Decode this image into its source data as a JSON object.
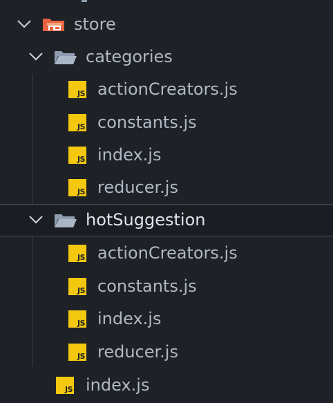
{
  "explorer": {
    "store": {
      "label": "store",
      "icon": "store-folder-icon",
      "color": "#e8633f"
    },
    "categories": {
      "label": "categories",
      "files": [
        {
          "label": "actionCreators.js"
        },
        {
          "label": "constants.js"
        },
        {
          "label": "index.js"
        },
        {
          "label": "reducer.js"
        }
      ]
    },
    "hotSuggestion": {
      "label": "hotSuggestion",
      "selected": true,
      "files": [
        {
          "label": "actionCreators.js"
        },
        {
          "label": "constants.js"
        },
        {
          "label": "index.js"
        },
        {
          "label": "reducer.js"
        }
      ]
    },
    "store_index": {
      "label": "index.js"
    },
    "js_badge_text": "JS",
    "colors": {
      "background": "#1e2227",
      "text": "#b0b8c4",
      "js_badge": "#f3c80f",
      "folder": "#8f9fb0"
    }
  }
}
